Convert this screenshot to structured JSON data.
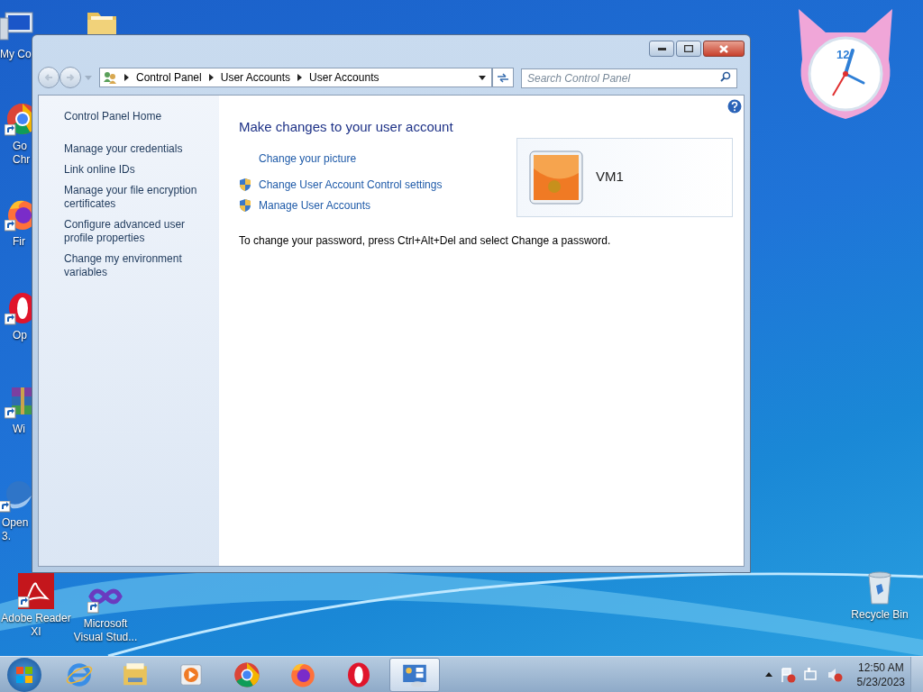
{
  "desktop_icons": [
    {
      "kind": "computer",
      "label_lines": [
        "My Co"
      ]
    },
    {
      "kind": "folder"
    },
    {
      "kind": "chrome",
      "label_lines": [
        "Go",
        "Chr"
      ]
    },
    {
      "kind": "firefox",
      "label_lines": [
        "Fir"
      ]
    },
    {
      "kind": "opera",
      "label_lines": [
        "Op"
      ]
    },
    {
      "kind": "archive",
      "label_lines": [
        "Wi"
      ]
    },
    {
      "kind": "openoffice",
      "label_lines": [
        "Open",
        "3."
      ]
    },
    {
      "kind": "pdf",
      "label_lines": [
        "Adobe Reader",
        "XI"
      ]
    },
    {
      "kind": "infinity",
      "label_lines": [
        "Microsoft",
        "Visual Stud..."
      ]
    },
    {
      "kind": "recycle",
      "label_lines": [
        "Recycle Bin"
      ]
    }
  ],
  "clock_gadget": {
    "numeral": "12"
  },
  "window": {
    "breadcrumb": [
      "Control Panel",
      "User Accounts",
      "User Accounts"
    ],
    "search": {
      "placeholder": "Search Control Panel"
    },
    "sidebar": {
      "items": [
        {
          "label": "Control Panel Home"
        },
        {
          "label": "Manage your credentials"
        },
        {
          "label": "Link online IDs"
        },
        {
          "label": "Manage your file encryption certificates"
        },
        {
          "label": "Configure advanced user profile properties"
        },
        {
          "label": "Change my environment variables"
        }
      ]
    },
    "heading": "Make changes to your user account",
    "links": [
      {
        "label": "Change your picture",
        "shield": false
      },
      {
        "label": "Change User Account Control settings",
        "shield": true
      },
      {
        "label": "Manage User Accounts",
        "shield": true
      }
    ],
    "account": {
      "name": "VM1"
    },
    "note": "To change your password, press Ctrl+Alt+Del and select Change a password."
  },
  "taskbar": {
    "items": [
      {
        "kind": "ie",
        "selected": false
      },
      {
        "kind": "explorer",
        "selected": false
      },
      {
        "kind": "media",
        "selected": false
      },
      {
        "kind": "chrome",
        "selected": false
      },
      {
        "kind": "firefox",
        "selected": false
      },
      {
        "kind": "opera",
        "selected": false
      },
      {
        "kind": "controlpanel",
        "selected": true
      }
    ],
    "time": "12:50 AM",
    "date": "5/23/2023"
  }
}
